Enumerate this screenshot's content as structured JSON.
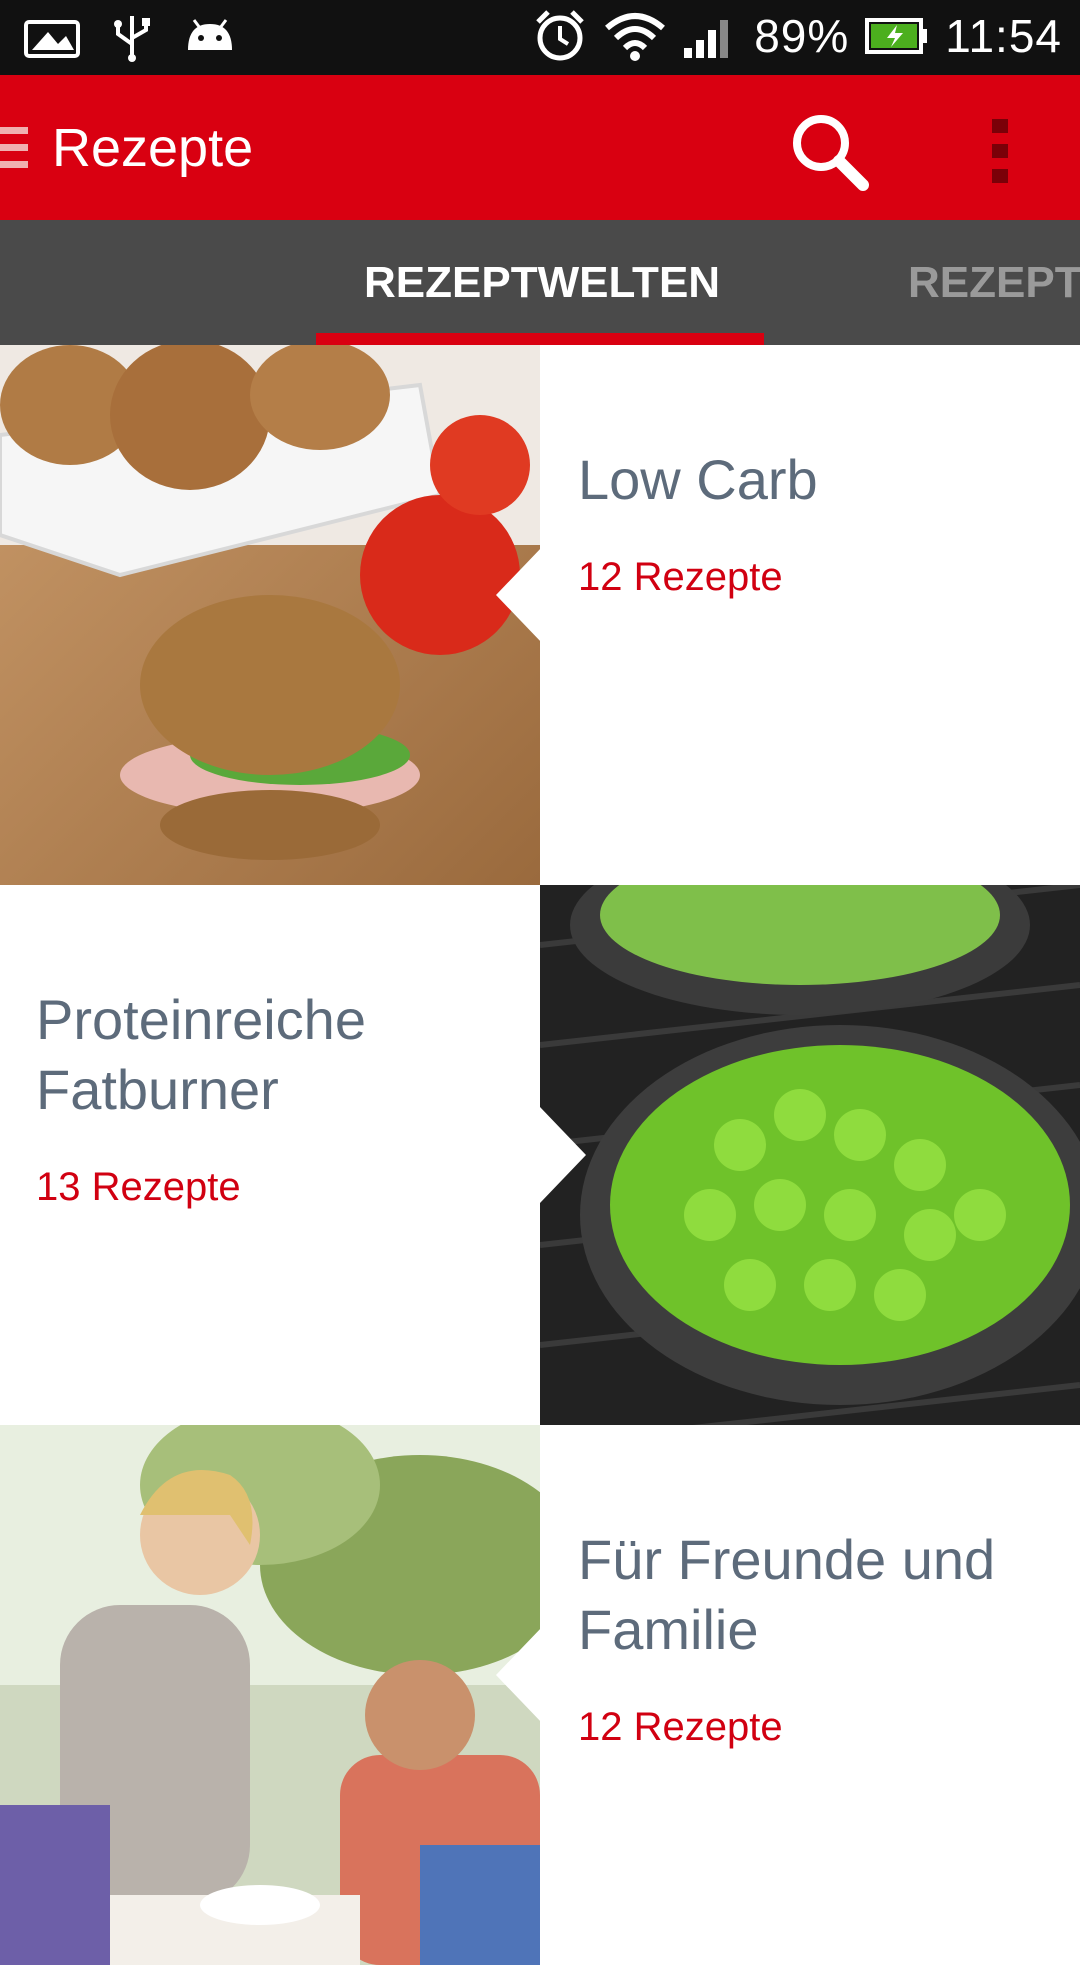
{
  "status_bar": {
    "battery": "89%",
    "time": "11:54",
    "icons": [
      "image-icon",
      "usb-icon",
      "android-icon",
      "alarm-icon",
      "wifi-icon",
      "signal-icon",
      "battery-charging-icon"
    ]
  },
  "app_bar": {
    "title": "Rezepte",
    "icons": [
      "menu-icon",
      "search-icon",
      "overflow-menu-icon"
    ]
  },
  "tabs": [
    {
      "label": "REZEPTWELTEN",
      "active": true
    },
    {
      "label": "REZEPT",
      "active": false
    }
  ],
  "categories": [
    {
      "title": "Low Carb",
      "count": "12 Rezepte",
      "image": "sandwich-photo"
    },
    {
      "title": "Proteinreiche Fatburner",
      "count": "13 Rezepte",
      "image": "edamame-photo"
    },
    {
      "title": "Für Freunde und Familie",
      "count": "12 Rezepte",
      "image": "family-dinner-photo"
    }
  ],
  "colors": {
    "accent": "#d90011",
    "tab_bar": "#4a4a4a",
    "title_text": "#5d6b7b",
    "count_text": "#d10011"
  }
}
